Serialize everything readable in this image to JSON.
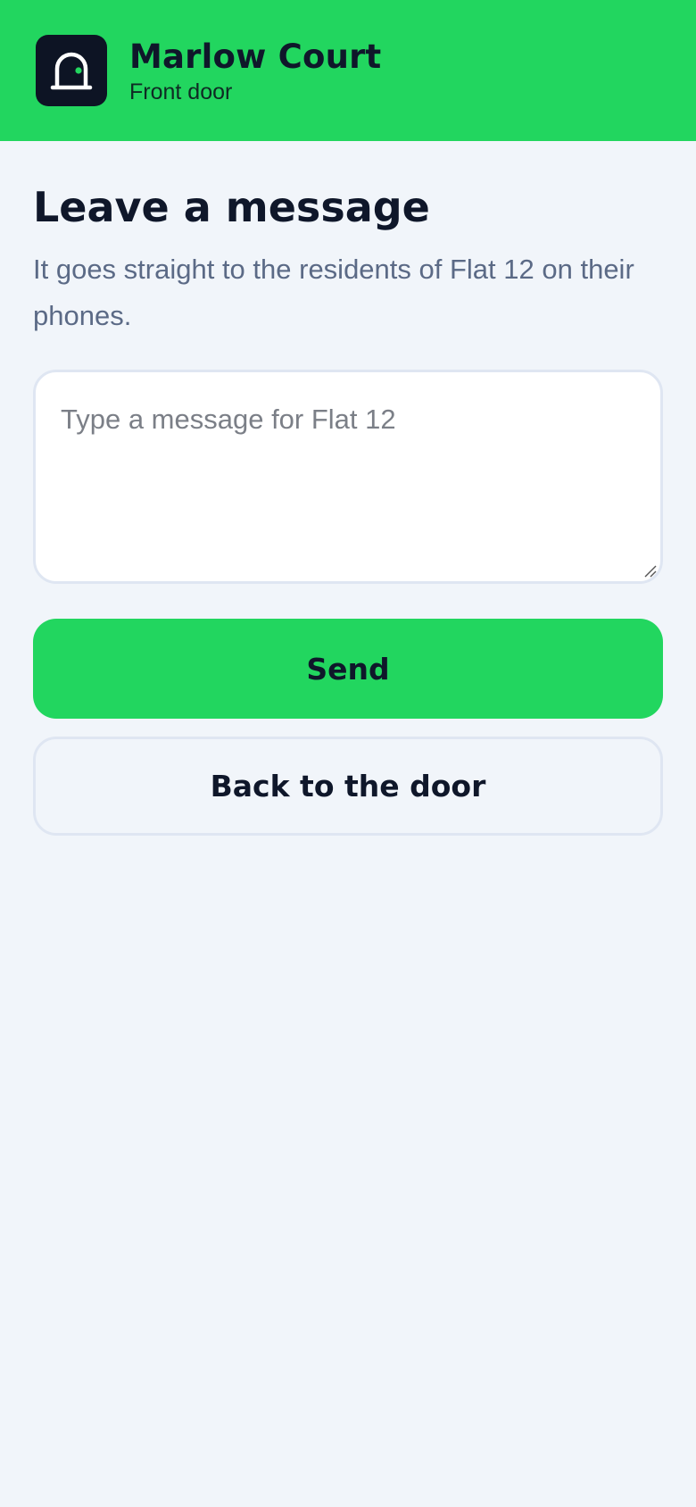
{
  "header": {
    "building_name": "Marlow Court",
    "entrance_name": "Front door",
    "logo_icon": "door-icon",
    "accent_color": "#22d65f",
    "logo_bg_color": "#0d1424"
  },
  "main": {
    "title": "Leave a message",
    "subtitle": "It goes straight to the residents of Flat 12 on their phones.",
    "message_field": {
      "placeholder": "Type a message for Flat 12",
      "value": ""
    },
    "send_label": "Send",
    "back_label": "Back to the door"
  }
}
